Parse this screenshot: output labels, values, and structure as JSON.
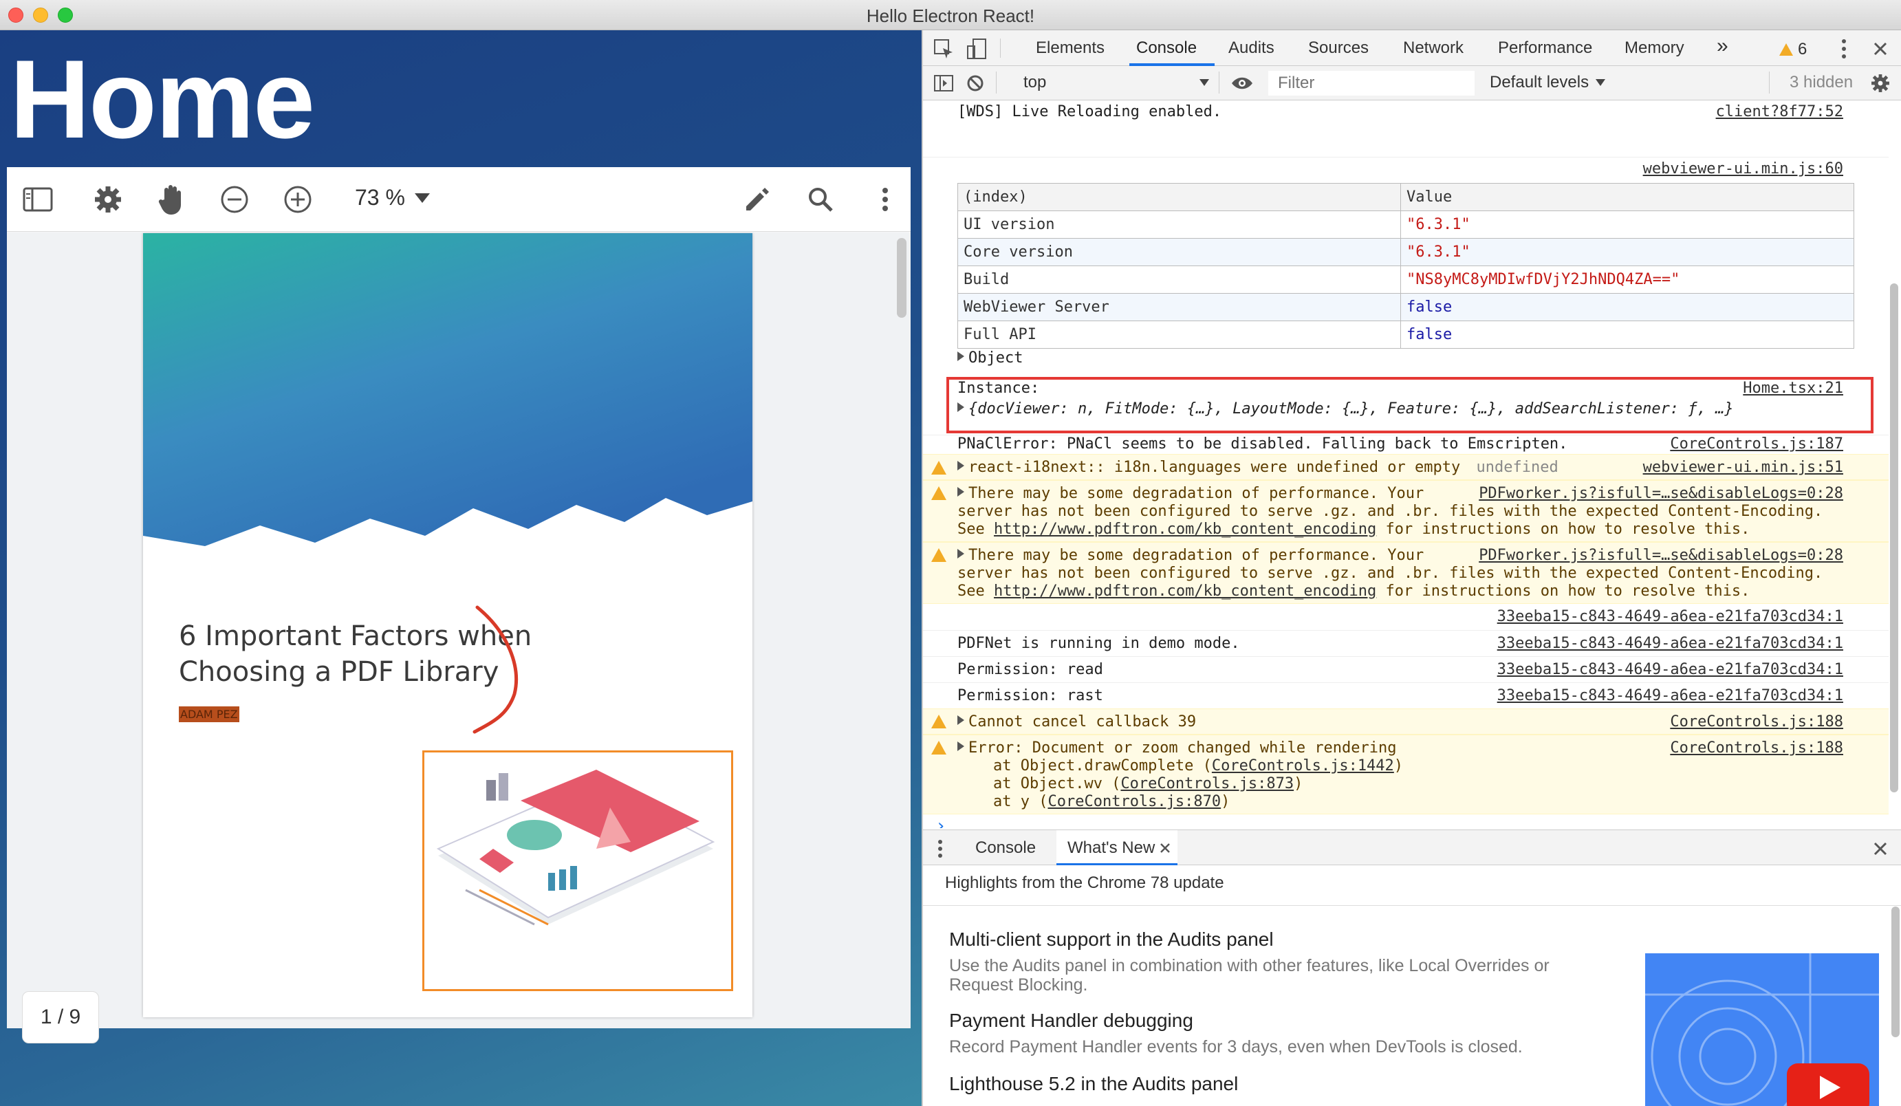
{
  "window": {
    "title": "Hello Electron React!"
  },
  "app": {
    "heading": "Home",
    "viewer": {
      "zoom_label": "73 %",
      "page_indicator": "1 / 9",
      "page": {
        "title_line1": "6 Important Factors when",
        "title_line2": "Choosing a PDF Library",
        "author": "ADAM PEZ"
      }
    }
  },
  "devtools": {
    "tabs": [
      "Elements",
      "Console",
      "Audits",
      "Sources",
      "Network",
      "Performance",
      "Memory"
    ],
    "active_tab": "Console",
    "more_tabs": "»",
    "warning_count": "6",
    "context": "top",
    "filter_placeholder": "Filter",
    "levels": "Default levels",
    "hidden": "3 hidden",
    "console": {
      "wds": {
        "text": "[WDS] Live Reloading enabled.",
        "src": "client?8f77:52"
      },
      "table_src": "webviewer-ui.min.js:60",
      "table": {
        "headers": [
          "(index)",
          "Value"
        ],
        "rows": [
          {
            "k": "UI version",
            "v": "\"6.3.1\""
          },
          {
            "k": "Core version",
            "v": "\"6.3.1\""
          },
          {
            "k": "Build",
            "v": "\"NS8yMC8yMDIwfDVjY2JhNDQ4ZA==\""
          },
          {
            "k": "WebViewer Server",
            "v": "false"
          },
          {
            "k": "Full API",
            "v": "false"
          }
        ]
      },
      "object": "Object",
      "instance_label": "Instance:",
      "instance_src": "Home.tsx:21",
      "instance_value": "{docViewer: n, FitMode: {…}, LayoutMode: {…}, Feature: {…}, addSearchListener: ƒ, …}",
      "pnacl": {
        "text": "PNaClError: PNaCl seems to be disabled. Falling back to Emscripten.",
        "src": "CoreControls.js:187"
      },
      "i18n": {
        "text": "react-i18next:: i18n.languages were undefined or empty",
        "extra": "undefined",
        "src": "webviewer-ui.min.js:51"
      },
      "perf1": {
        "line1": "There may be some degradation of performance. Your",
        "src": "PDFworker.js?isfull=…se&disableLogs=0:28",
        "line2": "server has not been configured to serve .gz. and .br. files with the expected Content-Encoding.",
        "line3_pre": "See",
        "url": "http://www.pdftron.com/kb_content_encoding",
        "line3_post": "for instructions on how to resolve this."
      },
      "perf2": {
        "line1": "There may be some degradation of performance. Your",
        "src": "PDFworker.js?isfull=…se&disableLogs=0:28",
        "line2": "server has not been configured to serve .gz. and .br. files with the expected Content-Encoding.",
        "line3_pre": "See",
        "url": "http://www.pdftron.com/kb_content_encoding",
        "line3_post": "for instructions on how to resolve this."
      },
      "uuid_src": "33eeba15-c843-4649-a6ea-e21fa703cd34:1",
      "demo": "PDFNet is running in demo mode.",
      "perm_read": "Permission: read",
      "perm_rast": "Permission: rast",
      "cancel": {
        "text": "Cannot cancel callback 39",
        "src": "CoreControls.js:188"
      },
      "error": {
        "text": "Error: Document or zoom changed while rendering",
        "src": "CoreControls.js:188",
        "stack1_pre": "at Object.drawComplete (",
        "stack1_link": "CoreControls.js:1442",
        "stack2_pre": "at Object.wv (",
        "stack2_link": "CoreControls.js:873",
        "stack3_pre": "at y (",
        "stack3_link": "CoreControls.js:870",
        "close": ")"
      },
      "prompt": "›"
    },
    "drawer": {
      "tabs": [
        "Console",
        "What's New"
      ],
      "highlights": "Highlights from the Chrome 78 update",
      "news": [
        {
          "title": "Multi-client support in the Audits panel",
          "desc": "Use the Audits panel in combination with other features, like Local Overrides or Request Blocking."
        },
        {
          "title": "Payment Handler debugging",
          "desc": "Record Payment Handler events for 3 days, even when DevTools is closed."
        },
        {
          "title": "Lighthouse 5.2 in the Audits panel",
          "desc": ""
        }
      ]
    }
  }
}
